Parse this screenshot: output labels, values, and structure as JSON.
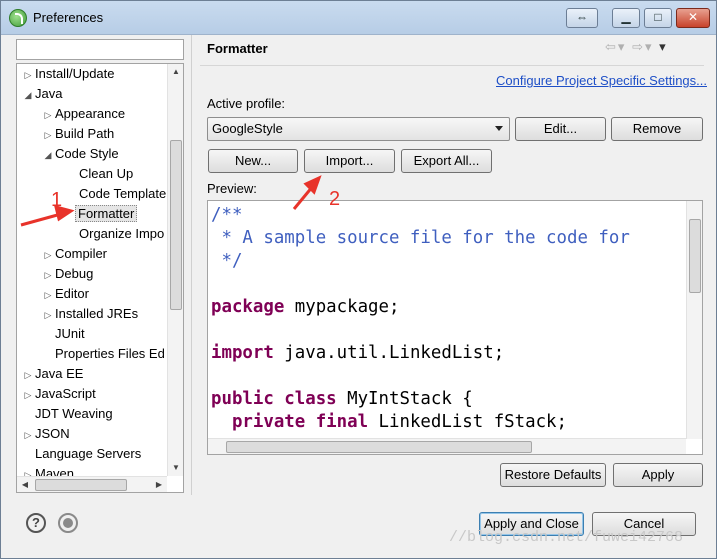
{
  "window": {
    "title": "Preferences"
  },
  "window_buttons": {
    "restore": "⇔",
    "minimize": "▁",
    "maximize": "□",
    "close": "✕"
  },
  "sidebar": {
    "filter_placeholder": "",
    "items": [
      {
        "label": "Install/Update",
        "arrow": "▷"
      },
      {
        "label": "Java",
        "arrow": "◢"
      },
      {
        "label": "Appearance",
        "arrow": "▷"
      },
      {
        "label": "Build Path",
        "arrow": "▷"
      },
      {
        "label": "Code Style",
        "arrow": "◢"
      },
      {
        "label": "Clean Up",
        "arrow": ""
      },
      {
        "label": "Code Template",
        "arrow": ""
      },
      {
        "label": "Formatter",
        "arrow": ""
      },
      {
        "label": "Organize Impo",
        "arrow": ""
      },
      {
        "label": "Compiler",
        "arrow": "▷"
      },
      {
        "label": "Debug",
        "arrow": "▷"
      },
      {
        "label": "Editor",
        "arrow": "▷"
      },
      {
        "label": "Installed JREs",
        "arrow": "▷"
      },
      {
        "label": "JUnit",
        "arrow": ""
      },
      {
        "label": "Properties Files Ed",
        "arrow": ""
      },
      {
        "label": "Java EE",
        "arrow": "▷"
      },
      {
        "label": "JavaScript",
        "arrow": "▷"
      },
      {
        "label": "JDT Weaving",
        "arrow": ""
      },
      {
        "label": "JSON",
        "arrow": "▷"
      },
      {
        "label": "Language Servers",
        "arrow": ""
      },
      {
        "label": "Maven",
        "arrow": "▷"
      }
    ]
  },
  "main": {
    "title": "Formatter",
    "configure_link": "Configure Project Specific Settings...",
    "active_profile_label": "Active profile:",
    "profile_value": "GoogleStyle",
    "edit_button": "Edit...",
    "remove_button": "Remove",
    "new_button": "New...",
    "import_button": "Import...",
    "export_button": "Export All...",
    "preview_label": "Preview:",
    "code_lines": {
      "l1": "/**",
      "l2": " * A sample source file for the code for",
      "l3": " */",
      "l5_kw": "package",
      "l5_rest": " mypackage;",
      "l7_kw": "import",
      "l7_rest": " java.util.LinkedList;",
      "l9_kw": "public class",
      "l9_rest": " MyIntStack {",
      "l10_kw": "  private final",
      "l10_rest": " LinkedList fStack;"
    },
    "restore_defaults_button": "Restore Defaults",
    "apply_button": "Apply"
  },
  "footer": {
    "apply_close_button": "Apply and Close",
    "cancel_button": "Cancel",
    "help_icon": "?",
    "record_icon": "record-icon"
  },
  "annotations": {
    "one": "1",
    "two": "2",
    "color": "#e8332a"
  },
  "watermark": "//blog.csdn.net/fuwei42768"
}
